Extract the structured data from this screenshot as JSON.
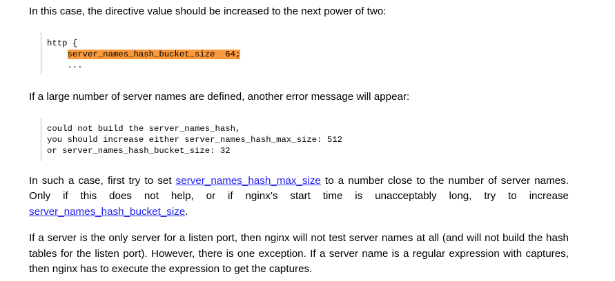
{
  "paragraphs": {
    "p1": "In this case, the directive value should be increased to the next power of two:",
    "p2": "If a large number of server names are defined, another error message will appear:",
    "p3_a": "In such a case, first try to set ",
    "p3_link1": "server_names_hash_max_size",
    "p3_b": " to a number close to the number of server names. Only if this does not help, or if nginx’s start time is unacceptably long, try to increase ",
    "p3_link2": "server_names_hash_bucket_size",
    "p3_c": ".",
    "p4": "If a server is the only server for a listen port, then nginx will not test server names at all (and will not build the hash tables for the listen port). However, there is one exception. If a server name is a regular expression with captures, then nginx has to execute the expression to get the captures."
  },
  "code1": {
    "line1": "http {",
    "indent": "    ",
    "highlighted": "server_names_hash_bucket_size  64;",
    "line3": "    ..."
  },
  "code2": {
    "line1": "could not build the server_names_hash,",
    "line2": "you should increase either server_names_hash_max_size: 512",
    "line3": "or server_names_hash_bucket_size: 32"
  },
  "colors": {
    "highlight": "#fa9a3c",
    "link": "#2222ee"
  }
}
